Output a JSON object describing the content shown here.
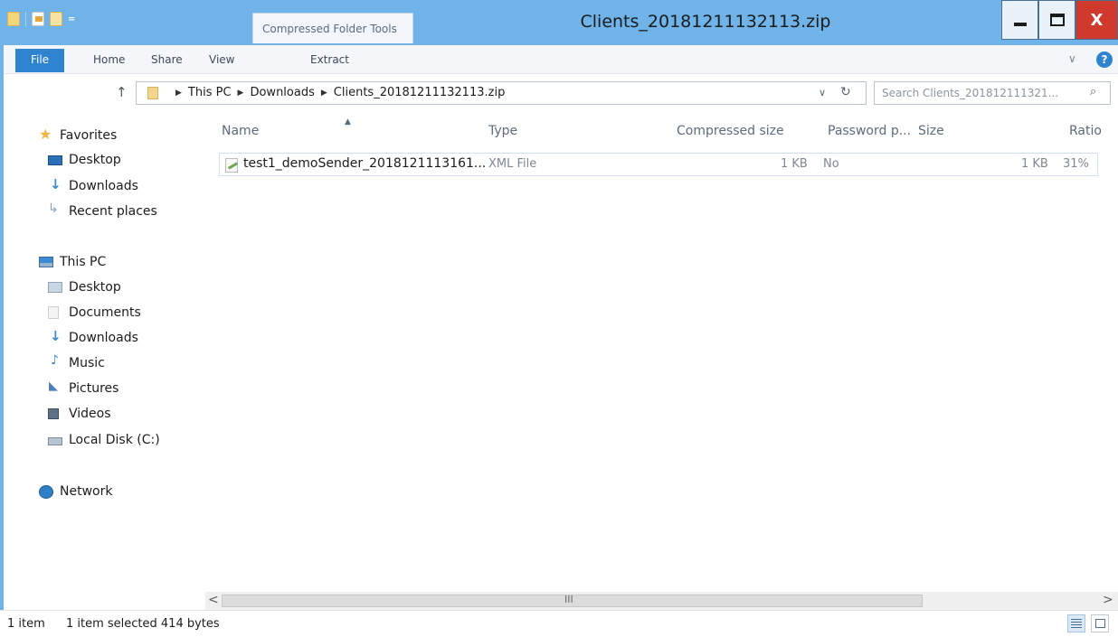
{
  "window": {
    "title": "Clients_20181211132113.zip",
    "context_tab": "Compressed Folder Tools",
    "close_glyph": "X"
  },
  "qat": {
    "dropdown": "="
  },
  "ribbon": {
    "file": "File",
    "tabs": [
      "Home",
      "Share",
      "View",
      "Extract"
    ],
    "collapse_chevron": "∨",
    "help": "?"
  },
  "address": {
    "up_arrow": "↑",
    "breadcrumbs": [
      "This PC",
      "Downloads",
      "Clients_20181211132113.zip"
    ],
    "separator": "▶",
    "dropdown": "∨",
    "refresh": "↻"
  },
  "search": {
    "placeholder": "Search Clients_201812111321...",
    "icon": "⌕"
  },
  "nav": {
    "favorites": {
      "header": "Favorites",
      "items": [
        "Desktop",
        "Downloads",
        "Recent places"
      ]
    },
    "this_pc": {
      "header": "This PC",
      "items": [
        "Desktop",
        "Documents",
        "Downloads",
        "Music",
        "Pictures",
        "Videos",
        "Local Disk (C:)"
      ]
    },
    "network": "Network"
  },
  "columns": {
    "name": "Name",
    "type": "Type",
    "compressed_size": "Compressed size",
    "password": "Password p...",
    "size": "Size",
    "ratio": "Ratio",
    "sort_indicator": "▲"
  },
  "files": [
    {
      "name": "test1_demoSender_2018121113161...",
      "type": "XML File",
      "compressed_size": "1 KB",
      "password": "No",
      "size": "1 KB",
      "ratio": "31%"
    }
  ],
  "scrollbar": {
    "left": "<",
    "right": ">",
    "grip": "III"
  },
  "status": {
    "count": "1 item",
    "selection": "1 item selected  414 bytes"
  },
  "colors": {
    "titlebar": "#6fb3e9",
    "file_tab": "#2f84cf",
    "close": "#d03a2c"
  },
  "icons": {
    "favorites": "star-icon",
    "desktop": "desktop-icon",
    "downloads": "downloads-icon",
    "recent": "recent-places-icon",
    "this_pc": "computer-icon",
    "documents": "documents-icon",
    "music": "music-icon",
    "pictures": "pictures-icon",
    "videos": "videos-icon",
    "disk": "disk-icon",
    "network": "network-icon",
    "xml": "xml-file-icon"
  }
}
